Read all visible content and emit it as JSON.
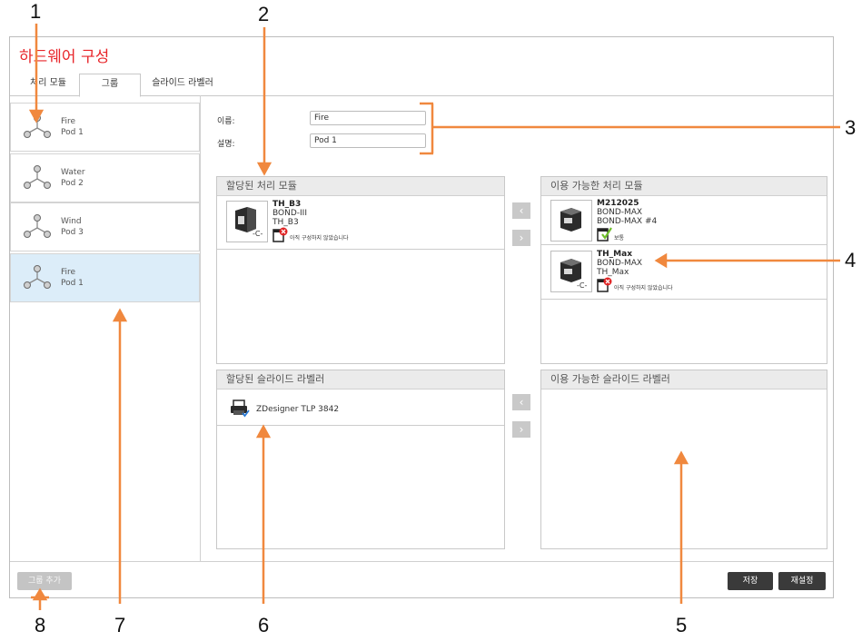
{
  "app": {
    "title": "하드웨어 구성"
  },
  "tabs": [
    {
      "label": "처리 모듈"
    },
    {
      "label": "그룹"
    },
    {
      "label": "슬라이드 라벨러"
    }
  ],
  "pods": [
    {
      "name": "Fire",
      "desc": "Pod 1"
    },
    {
      "name": "Water",
      "desc": "Pod 2"
    },
    {
      "name": "Wind",
      "desc": "Pod 3"
    },
    {
      "name": "Fire",
      "desc": "Pod 1",
      "selected": true
    }
  ],
  "form": {
    "name_label": "이름:",
    "name_value": "Fire",
    "desc_label": "설명:",
    "desc_value": "Pod 1"
  },
  "assigned_modules": {
    "header": "할당된 처리 모듈",
    "items": [
      {
        "name": "TH_B3",
        "type": "BOND-III",
        "alias": "TH_B3",
        "status": "아직 구성하지 않았습니다",
        "status_icon": "error-x-icon"
      }
    ]
  },
  "available_modules": {
    "header": "이용 가능한 처리 모듈",
    "items": [
      {
        "name": "M212025",
        "type": "BOND-MAX",
        "alias": "BOND-MAX #4",
        "status": "보통",
        "status_icon": "check-icon"
      },
      {
        "name": "TH_Max",
        "type": "BOND-MAX",
        "alias": "TH_Max",
        "status": "아직 구성하지 않았습니다",
        "status_icon": "error-x-icon"
      }
    ]
  },
  "assigned_labelers": {
    "header": "할당된 슬라이드 라벨러",
    "items": [
      {
        "name": "ZDesigner TLP 3842"
      }
    ]
  },
  "available_labelers": {
    "header": "이용 가능한 슬라이드 라벨러",
    "items": []
  },
  "footer": {
    "add_group": "그룹 추가",
    "save": "저장",
    "reset": "재설정"
  },
  "callouts": [
    "1",
    "2",
    "3",
    "4",
    "5",
    "6",
    "7",
    "8"
  ],
  "colors": {
    "title_red": "#e8262b",
    "callout_orange": "#f0883e",
    "selected_bg": "#dcedf9",
    "dark_button": "#3a3a3a"
  }
}
